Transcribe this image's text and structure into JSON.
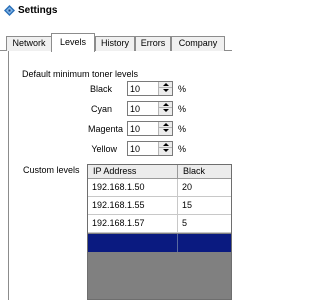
{
  "window": {
    "title": "Settings",
    "icon": "settings-icon"
  },
  "tabs": [
    {
      "label": "Network",
      "active": false
    },
    {
      "label": "Levels",
      "active": true
    },
    {
      "label": "History",
      "active": false
    },
    {
      "label": "Errors",
      "active": false
    },
    {
      "label": "Company",
      "active": false
    }
  ],
  "toner": {
    "section_label": "Default minimum toner levels",
    "unit": "%",
    "items": [
      {
        "label": "Black",
        "value": "10"
      },
      {
        "label": "Cyan",
        "value": "10"
      },
      {
        "label": "Magenta",
        "value": "10"
      },
      {
        "label": "Yellow",
        "value": "10"
      }
    ]
  },
  "custom_levels": {
    "label": "Custom levels",
    "columns": [
      "IP Address",
      "Black"
    ],
    "rows": [
      [
        "192.168.1.50",
        "20"
      ],
      [
        "192.168.1.55",
        "15"
      ],
      [
        "192.168.1.57",
        "5"
      ]
    ],
    "selected_row_color": "#0a1a80"
  }
}
